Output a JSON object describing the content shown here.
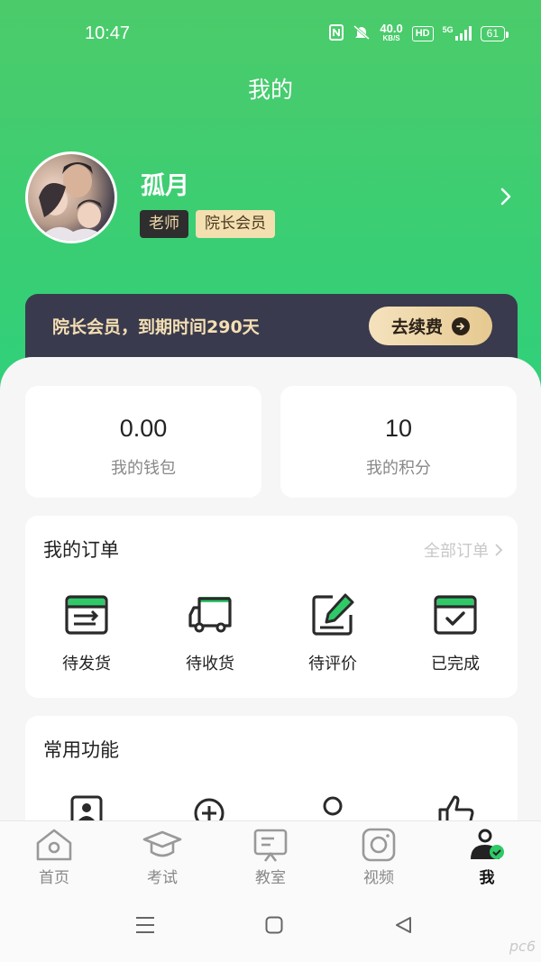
{
  "status_bar": {
    "time": "10:47",
    "net_speed": "40.0",
    "net_unit": "KB/S",
    "hd": "HD",
    "network": "5G",
    "battery": "61"
  },
  "page": {
    "title": "我的"
  },
  "profile": {
    "name": "孤月",
    "role_badge": "老师",
    "vip_badge": "院长会员"
  },
  "vip": {
    "text": "院长会员，到期时间290天",
    "renew_label": "去续费"
  },
  "stats": [
    {
      "value": "0.00",
      "label": "我的钱包"
    },
    {
      "value": "10",
      "label": "我的积分"
    }
  ],
  "orders": {
    "title": "我的订单",
    "all_label": "全部订单",
    "items": [
      {
        "label": "待发货",
        "icon": "package-send-icon"
      },
      {
        "label": "待收货",
        "icon": "truck-icon"
      },
      {
        "label": "待评价",
        "icon": "edit-note-icon"
      },
      {
        "label": "已完成",
        "icon": "completed-box-icon"
      }
    ]
  },
  "functions": {
    "title": "常用功能",
    "icons": [
      "id-card-icon",
      "add-circle-icon",
      "user-icon",
      "thumbs-up-icon"
    ]
  },
  "tabs": [
    {
      "label": "首页",
      "icon": "home-icon"
    },
    {
      "label": "考试",
      "icon": "graduation-cap-icon"
    },
    {
      "label": "教室",
      "icon": "classroom-icon"
    },
    {
      "label": "视频",
      "icon": "video-icon"
    },
    {
      "label": "我",
      "icon": "profile-icon",
      "active": true
    }
  ],
  "colors": {
    "accent_green": "#2fc968",
    "header_top": "#4ccb6a",
    "vip_bar": "#3a3a4e",
    "vip_gold": "#f4dfb3"
  },
  "watermark": "pc6"
}
